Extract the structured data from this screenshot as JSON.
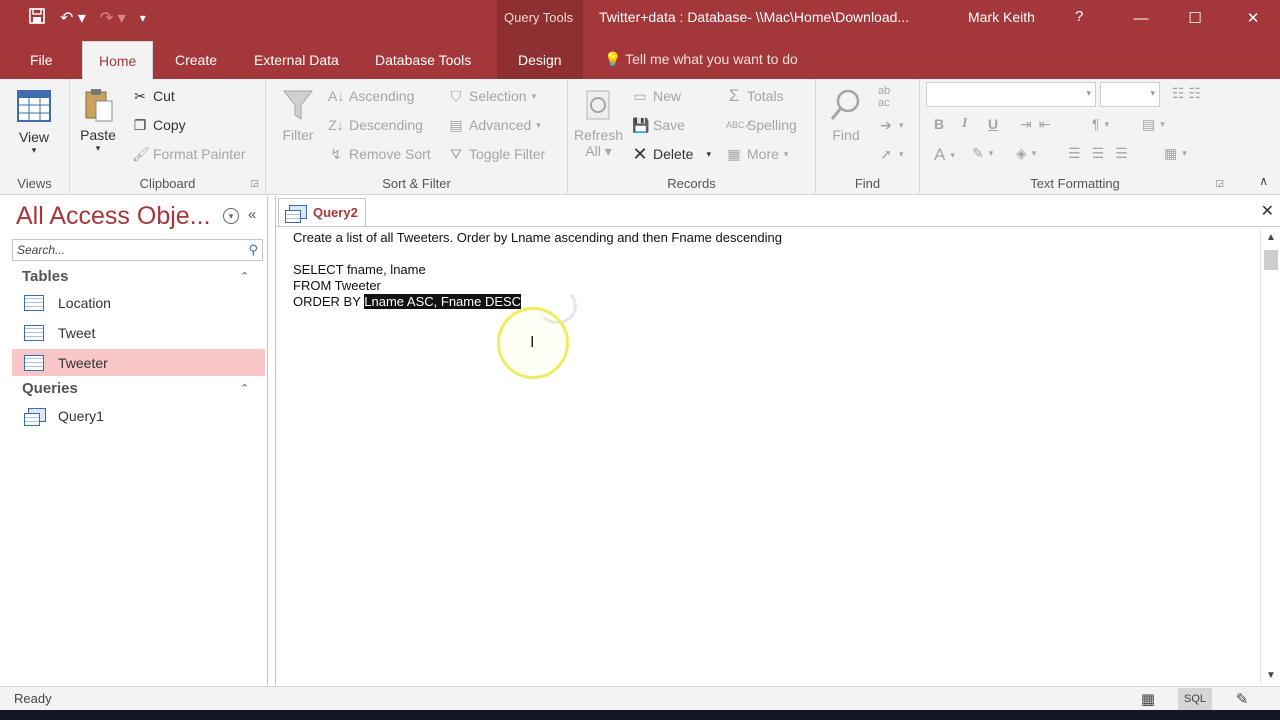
{
  "titlebar": {
    "context_tab_label": "Query Tools",
    "document_title": "Twitter+data : Database- \\\\Mac\\Home\\Download...",
    "user_name": "Mark Keith",
    "help": "?"
  },
  "tabs": {
    "file": "File",
    "home": "Home",
    "create": "Create",
    "external_data": "External Data",
    "database_tools": "Database Tools",
    "design": "Design",
    "tell_me": "Tell me what you want to do"
  },
  "ribbon": {
    "views": {
      "label": "Views",
      "view": "View"
    },
    "clipboard": {
      "label": "Clipboard",
      "paste": "Paste",
      "cut": "Cut",
      "copy": "Copy",
      "format_painter": "Format Painter"
    },
    "sort_filter": {
      "label": "Sort & Filter",
      "filter": "Filter",
      "ascending": "Ascending",
      "descending": "Descending",
      "remove_sort": "Remove Sort",
      "selection": "Selection",
      "advanced": "Advanced",
      "toggle_filter": "Toggle Filter"
    },
    "records": {
      "label": "Records",
      "refresh_line1": "Refresh",
      "refresh_line2": "All",
      "new": "New",
      "save": "Save",
      "delete": "Delete",
      "totals": "Totals",
      "spelling": "Spelling",
      "more": "More"
    },
    "find": {
      "label": "Find",
      "find": "Find"
    },
    "text_formatting": {
      "label": "Text Formatting",
      "bold": "B",
      "italic": "I",
      "underline": "U",
      "font_color": "A"
    }
  },
  "nav": {
    "title": "All Access Obje...",
    "search_placeholder": "Search...",
    "tables_header": "Tables",
    "tables": [
      "Location",
      "Tweet",
      "Tweeter"
    ],
    "queries_header": "Queries",
    "queries": [
      "Query1"
    ]
  },
  "document": {
    "tab_label": "Query2",
    "sql_lines": [
      "Create a list of all Tweeters. Order by Lname ascending and then Fname descending",
      "",
      "SELECT fname, lname",
      "FROM Tweeter"
    ],
    "order_by_prefix": "ORDER BY ",
    "order_by_selected": "Lname ASC, Fname DESC"
  },
  "status": {
    "text": "Ready",
    "view_sql": "SQL"
  },
  "colors": {
    "brand": "#a4373a",
    "selection_nav": "#f9c7c8"
  }
}
